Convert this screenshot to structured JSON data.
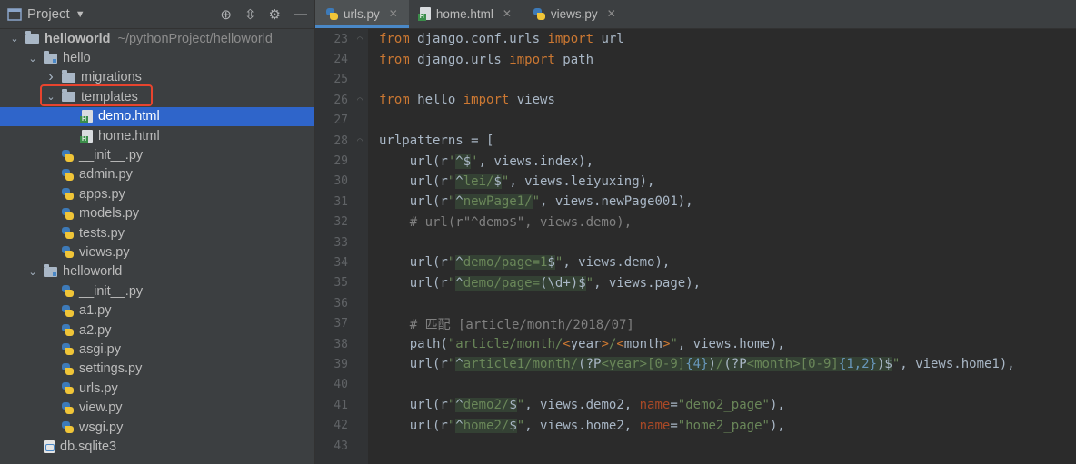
{
  "sidebar": {
    "title": "Project",
    "project_path": "~/pythonProject/helloworld",
    "items": [
      {
        "label": "helloworld",
        "level": 0,
        "kind": "folder",
        "arrow": "⌄"
      },
      {
        "label": "hello",
        "level": 1,
        "kind": "folder",
        "arrow": "⌄"
      },
      {
        "label": "migrations",
        "level": 2,
        "kind": "folder",
        "arrow": "›"
      },
      {
        "label": "templates",
        "level": 2,
        "kind": "folder",
        "arrow": "⌄"
      },
      {
        "label": "demo.html",
        "level": 3,
        "kind": "html",
        "selected": true
      },
      {
        "label": "home.html",
        "level": 3,
        "kind": "html"
      },
      {
        "label": "__init__.py",
        "level": 2,
        "kind": "py"
      },
      {
        "label": "admin.py",
        "level": 2,
        "kind": "py"
      },
      {
        "label": "apps.py",
        "level": 2,
        "kind": "py"
      },
      {
        "label": "models.py",
        "level": 2,
        "kind": "py"
      },
      {
        "label": "tests.py",
        "level": 2,
        "kind": "py"
      },
      {
        "label": "views.py",
        "level": 2,
        "kind": "py"
      },
      {
        "label": "helloworld",
        "level": 1,
        "kind": "folder",
        "arrow": "⌄"
      },
      {
        "label": "__init__.py",
        "level": 2,
        "kind": "py"
      },
      {
        "label": "a1.py",
        "level": 2,
        "kind": "py"
      },
      {
        "label": "a2.py",
        "level": 2,
        "kind": "py"
      },
      {
        "label": "asgi.py",
        "level": 2,
        "kind": "py"
      },
      {
        "label": "settings.py",
        "level": 2,
        "kind": "py"
      },
      {
        "label": "urls.py",
        "level": 2,
        "kind": "py"
      },
      {
        "label": "view.py",
        "level": 2,
        "kind": "py"
      },
      {
        "label": "wsgi.py",
        "level": 2,
        "kind": "py"
      },
      {
        "label": "db.sqlite3",
        "level": 1,
        "kind": "db"
      }
    ]
  },
  "tabs": [
    {
      "label": "urls.py",
      "icon": "python-file-icon",
      "active": true
    },
    {
      "label": "home.html",
      "icon": "html-file-icon",
      "active": false
    },
    {
      "label": "views.py",
      "icon": "python-file-icon",
      "active": false
    }
  ],
  "editor": {
    "line_numbers": [
      "23",
      "24",
      "25",
      "26",
      "27",
      "28",
      "29",
      "30",
      "31",
      "32",
      "33",
      "34",
      "35",
      "36",
      "37",
      "38",
      "39",
      "40",
      "41",
      "42",
      "43"
    ],
    "lines": [
      [
        "from django.conf.urls import url"
      ],
      [
        "from django.urls import path"
      ],
      [
        ""
      ],
      [
        "from hello import views"
      ],
      [
        ""
      ],
      [
        "urlpatterns = ["
      ],
      [
        "    url(r'^$', views.index),"
      ],
      [
        "    url(r\"^lei/$\", views.leiyuxing),"
      ],
      [
        "    url(r\"^newPage1/\", views.newPage001),"
      ],
      [
        "    # url(r\"^demo$\", views.demo),"
      ],
      [
        ""
      ],
      [
        "    url(r\"^demo/page=1$\", views.demo),"
      ],
      [
        "    url(r\"^demo/page=(\\d+)$\", views.page),"
      ],
      [
        ""
      ],
      [
        "    # 匹配 [article/month/2018/07]"
      ],
      [
        "    path(\"article/month/<year>/<month>\", views.home),"
      ],
      [
        "    url(r\"^article1/month/(?P<year>[0-9]{4})/(?P<month>[0-9]{1,2})$\", views.home1),"
      ],
      [
        ""
      ],
      [
        "    url(r\"^demo2/$\", views.demo2, name=\"demo2_page\"),"
      ],
      [
        "    url(r\"^home2/$\", views.home2, name=\"home2_page\"),"
      ],
      [
        ""
      ]
    ]
  }
}
